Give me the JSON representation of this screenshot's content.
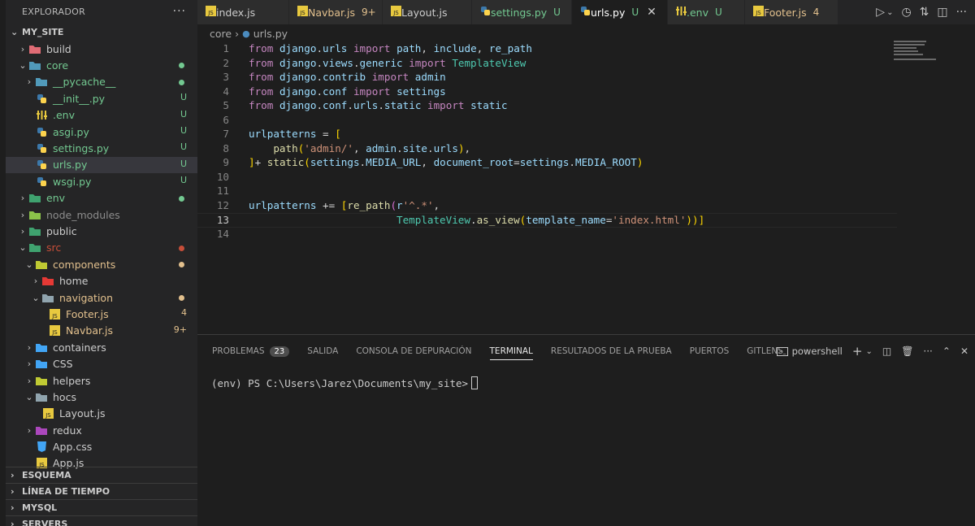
{
  "sidebar": {
    "header": "EXPLORADOR",
    "more": "···",
    "root": "MY_SITE",
    "items": [
      {
        "label": "build",
        "kind": "folder",
        "icon_color": "#e06c75",
        "status": "",
        "color": "plain"
      },
      {
        "label": "core",
        "kind": "folder-open",
        "icon_color": "#519aba",
        "status": "dot",
        "color": "green"
      },
      {
        "label": "__pycache__",
        "kind": "folder",
        "icon_color": "#519aba",
        "status": "dot",
        "color": "green"
      },
      {
        "label": "__init__.py",
        "kind": "python",
        "status": "U",
        "color": "green"
      },
      {
        "label": ".env",
        "kind": "env",
        "status": "U",
        "color": "green"
      },
      {
        "label": "asgi.py",
        "kind": "python",
        "status": "U",
        "color": "green"
      },
      {
        "label": "settings.py",
        "kind": "python",
        "status": "U",
        "color": "green"
      },
      {
        "label": "urls.py",
        "kind": "python",
        "status": "U",
        "color": "green"
      },
      {
        "label": "wsgi.py",
        "kind": "python",
        "status": "U",
        "color": "green"
      },
      {
        "label": "env",
        "kind": "folder",
        "icon_color": "#3fa26f",
        "status": "dot",
        "color": "green"
      },
      {
        "label": "node_modules",
        "kind": "folder",
        "icon_color": "#8bc34a",
        "status": "",
        "color": "gray"
      },
      {
        "label": "public",
        "kind": "folder",
        "icon_color": "#3fa26f",
        "status": "",
        "color": "plain"
      },
      {
        "label": "src",
        "kind": "folder-open",
        "icon_color": "#3fa26f",
        "status": "dot",
        "color": "red"
      },
      {
        "label": "components",
        "kind": "folder-open",
        "icon_color": "#c0ca33",
        "status": "dot",
        "color": "orange"
      },
      {
        "label": "home",
        "kind": "folder",
        "icon_color": "#e53935",
        "status": "",
        "color": "plain"
      },
      {
        "label": "navigation",
        "kind": "folder-open",
        "icon_color": "#90a4ae",
        "status": "dot",
        "color": "orange"
      },
      {
        "label": "Footer.js",
        "kind": "js",
        "status": "4",
        "color": "orange"
      },
      {
        "label": "Navbar.js",
        "kind": "js",
        "status": "9+",
        "color": "orange"
      },
      {
        "label": "containers",
        "kind": "folder",
        "icon_color": "#42a5f5",
        "status": "",
        "color": "plain"
      },
      {
        "label": "CSS",
        "kind": "folder",
        "icon_color": "#42a5f5",
        "status": "",
        "color": "plain"
      },
      {
        "label": "helpers",
        "kind": "folder",
        "icon_color": "#c0ca33",
        "status": "",
        "color": "plain"
      },
      {
        "label": "hocs",
        "kind": "folder-open",
        "icon_color": "#90a4ae",
        "status": "",
        "color": "plain"
      },
      {
        "label": "Layout.js",
        "kind": "js",
        "status": "",
        "color": "plain"
      },
      {
        "label": "redux",
        "kind": "folder",
        "icon_color": "#ab47bc",
        "status": "",
        "color": "plain"
      },
      {
        "label": "App.css",
        "kind": "css",
        "status": "",
        "color": "plain"
      },
      {
        "label": "App.js",
        "kind": "js",
        "status": "",
        "color": "plain"
      }
    ],
    "bottom_sections": [
      "ESQUEMA",
      "LÍNEA DE TIEMPO",
      "MYSQL",
      "SERVERS"
    ]
  },
  "tabs": [
    {
      "label": "index.js",
      "kind": "js",
      "flag": "",
      "color": "plain"
    },
    {
      "label": "Navbar.js",
      "kind": "js",
      "flag": "9+",
      "color": "orange"
    },
    {
      "label": "Layout.js",
      "kind": "js",
      "flag": "",
      "color": "plain"
    },
    {
      "label": "settings.py",
      "kind": "python",
      "flag": "U",
      "color": "green"
    },
    {
      "label": "urls.py",
      "kind": "python",
      "flag": "U",
      "color": "green",
      "active": true
    },
    {
      "label": ".env",
      "kind": "env",
      "flag": "U",
      "color": "green"
    },
    {
      "label": "Footer.js",
      "kind": "js",
      "flag": "4",
      "color": "orange"
    }
  ],
  "tab_close": "✕",
  "breadcrumb": {
    "folder": "core",
    "sep": "›",
    "file": "urls.py"
  },
  "editor": {
    "lines": [
      "from django.urls import path, include, re_path",
      "from django.views.generic import TemplateView",
      "from django.contrib import admin",
      "from django.conf import settings",
      "from django.conf.urls.static import static",
      "",
      "urlpatterns = [",
      "    path('admin/', admin.site.urls),",
      "]+ static(settings.MEDIA_URL, document_root=settings.MEDIA_ROOT)",
      "",
      "",
      "urlpatterns += [re_path(r'^.*',",
      "                        TemplateView.as_view(template_name='index.html'))]",
      ""
    ],
    "current_line": 13
  },
  "panel": {
    "tabs": [
      "PROBLEMAS",
      "SALIDA",
      "CONSOLA DE DEPURACIÓN",
      "TERMINAL",
      "RESULTADOS DE LA PRUEBA",
      "PUERTOS",
      "GITLENS"
    ],
    "problems_count": "23",
    "active_tab": "TERMINAL",
    "more": "···",
    "shell": "powershell",
    "terminal_prompt": "(env) PS C:\\Users\\Jarez\\Documents\\my_site>"
  },
  "colors": {
    "green": "#73c991",
    "orange": "#e2c08d",
    "red": "#c74e39",
    "accent_blue": "#007acc"
  }
}
